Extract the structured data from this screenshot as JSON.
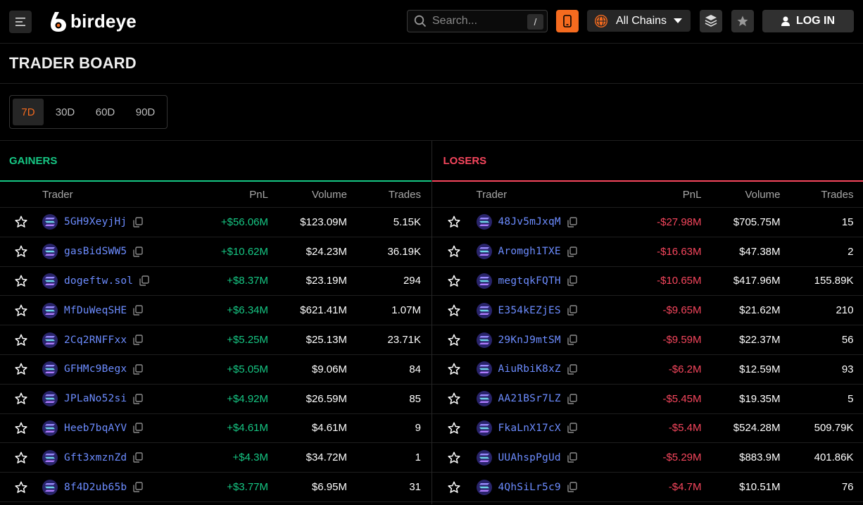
{
  "header": {
    "logo_text": "birdeye",
    "search_placeholder": "Search...",
    "search_shortcut": "/",
    "chains_label": "All Chains",
    "login_label": "LOG IN"
  },
  "page_title": "TRADER BOARD",
  "periods": [
    {
      "label": "7D",
      "active": true
    },
    {
      "label": "30D",
      "active": false
    },
    {
      "label": "60D",
      "active": false
    },
    {
      "label": "90D",
      "active": false
    }
  ],
  "columns": {
    "trader": "Trader",
    "pnl": "PnL",
    "volume": "Volume",
    "trades": "Trades"
  },
  "gainers": {
    "title": "GAINERS",
    "rows": [
      {
        "trader": "5GH9XeyjHj",
        "pnl": "+$56.06M",
        "volume": "$123.09M",
        "trades": "5.15K"
      },
      {
        "trader": "gasBidSWW5",
        "pnl": "+$10.62M",
        "volume": "$24.23M",
        "trades": "36.19K"
      },
      {
        "trader": "dogeftw.sol",
        "pnl": "+$8.37M",
        "volume": "$23.19M",
        "trades": "294"
      },
      {
        "trader": "MfDuWeqSHE",
        "pnl": "+$6.34M",
        "volume": "$621.41M",
        "trades": "1.07M"
      },
      {
        "trader": "2Cq2RNFFxx",
        "pnl": "+$5.25M",
        "volume": "$25.13M",
        "trades": "23.71K"
      },
      {
        "trader": "GFHMc9Begx",
        "pnl": "+$5.05M",
        "volume": "$9.06M",
        "trades": "84"
      },
      {
        "trader": "JPLaNo52si",
        "pnl": "+$4.92M",
        "volume": "$26.59M",
        "trades": "85"
      },
      {
        "trader": "Heeb7bqAYV",
        "pnl": "+$4.61M",
        "volume": "$4.61M",
        "trades": "9"
      },
      {
        "trader": "Gft3xmznZd",
        "pnl": "+$4.3M",
        "volume": "$34.72M",
        "trades": "1"
      },
      {
        "trader": "8f4D2ub65b",
        "pnl": "+$3.77M",
        "volume": "$6.95M",
        "trades": "31"
      }
    ]
  },
  "losers": {
    "title": "LOSERS",
    "rows": [
      {
        "trader": "48Jv5mJxqM",
        "pnl": "-$27.98M",
        "volume": "$705.75M",
        "trades": "15"
      },
      {
        "trader": "Aromgh1TXE",
        "pnl": "-$16.63M",
        "volume": "$47.38M",
        "trades": "2"
      },
      {
        "trader": "megtqkFQTH",
        "pnl": "-$10.65M",
        "volume": "$417.96M",
        "trades": "155.89K"
      },
      {
        "trader": "E354kEZjES",
        "pnl": "-$9.65M",
        "volume": "$21.62M",
        "trades": "210"
      },
      {
        "trader": "29KnJ9mtSM",
        "pnl": "-$9.59M",
        "volume": "$22.37M",
        "trades": "56"
      },
      {
        "trader": "AiuRbiK8xZ",
        "pnl": "-$6.2M",
        "volume": "$12.59M",
        "trades": "93"
      },
      {
        "trader": "AA21BSr7LZ",
        "pnl": "-$5.45M",
        "volume": "$19.35M",
        "trades": "5"
      },
      {
        "trader": "FkaLnX17cX",
        "pnl": "-$5.4M",
        "volume": "$524.28M",
        "trades": "509.79K"
      },
      {
        "trader": "UUAhspPgUd",
        "pnl": "-$5.29M",
        "volume": "$883.9M",
        "trades": "401.86K"
      },
      {
        "trader": "4QhSiLr5c9",
        "pnl": "-$4.7M",
        "volume": "$10.51M",
        "trades": "76"
      }
    ]
  },
  "colors": {
    "accent": "#f56b1f",
    "gain": "#16c784",
    "loss": "#f6465d",
    "link": "#6c8cff",
    "background": "#000000"
  },
  "icons": [
    "menu-icon",
    "logo-icon",
    "search-icon",
    "mobile-icon",
    "globe-icon",
    "chevron-down-icon",
    "layers-icon",
    "star-icon",
    "user-icon",
    "solana-icon",
    "copy-icon"
  ]
}
